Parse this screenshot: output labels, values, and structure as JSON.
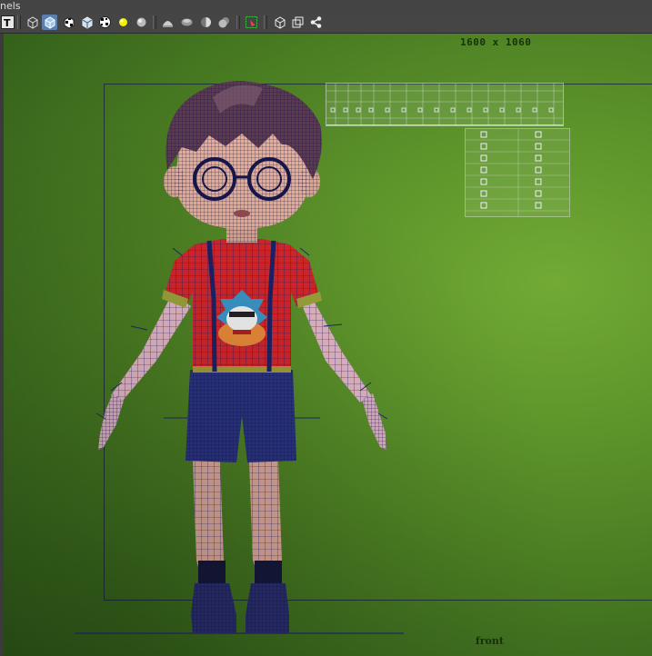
{
  "menubar": {
    "label": "nels"
  },
  "toolbar": {
    "tools": [
      "text-tool-icon",
      "wireframe-cube-icon",
      "shaded-cube-icon",
      "checker-cube-icon",
      "textured-cube-icon",
      "checker-sphere-icon",
      "light-bulb-icon",
      "sphere-icon",
      "dome-light-icon",
      "flat-shade-icon",
      "half-shade-icon",
      "smooth-shade-icon",
      "select-region-icon",
      "cube-view-icon",
      "isolate-icon",
      "share-network-icon"
    ]
  },
  "viewport": {
    "resolution_label": "1600 x 1060",
    "camera_label": "front",
    "background_color": "#5a8f2a"
  }
}
